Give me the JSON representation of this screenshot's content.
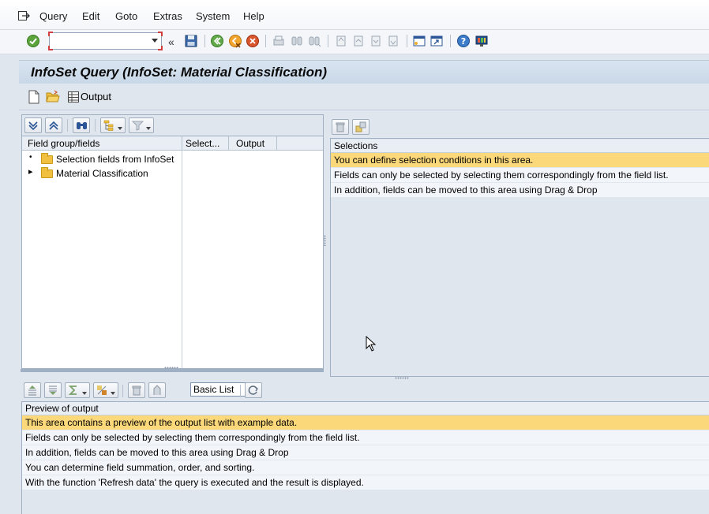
{
  "menu": {
    "items": [
      {
        "label": "Query"
      },
      {
        "label": "Edit"
      },
      {
        "label": "Goto"
      },
      {
        "label": "Extras"
      },
      {
        "label": "System"
      },
      {
        "label": "Help"
      }
    ]
  },
  "toolbar": {
    "command_field_value": "",
    "collapse_glyph": "«"
  },
  "title": "InfoSet Query (InfoSet: Material Classification)",
  "app_toolbar": {
    "output_label": "Output"
  },
  "field_list": {
    "columns": [
      "Field group/fields",
      "Select...",
      "Output"
    ],
    "items": [
      {
        "label": "Selection fields from InfoSet",
        "expander": "•"
      },
      {
        "label": "Material Classification",
        "expander": "▸"
      }
    ]
  },
  "selections": {
    "header": "Selections",
    "rows": [
      "You can define selection conditions in this area.",
      "Fields can only be selected by selecting them correspondingly from the field list.",
      "In addition, fields can be moved to this area using Drag & Drop"
    ]
  },
  "preview": {
    "list_type_value": "Basic List",
    "header": "Preview of output",
    "rows": [
      "This area contains a preview of the output list with example data.",
      "Fields can only be selected by selecting them correspondingly from the field list.",
      "In addition, fields can be moved to this area using Drag & Drop",
      "You can determine field summation, order, and sorting.",
      "With the function 'Refresh data' the query is executed and the result is displayed."
    ]
  },
  "colors": {
    "highlight": "#fbd87a",
    "title_bg": "#c9d8e8",
    "panel_border": "#9fb0c4"
  }
}
